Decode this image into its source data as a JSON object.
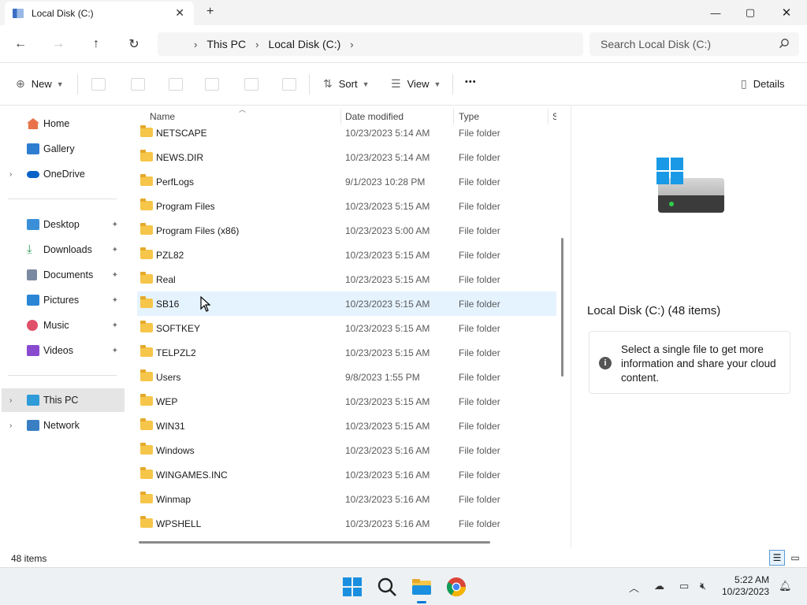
{
  "window": {
    "tab_title": "Local Disk (C:)",
    "tab_close": "✕",
    "new_tab": "+",
    "minimize": "—",
    "maximize": "▢",
    "close": "✕"
  },
  "address": {
    "crumbs": [
      "This PC",
      "Local Disk (C:)"
    ],
    "separator": "›",
    "search_placeholder": "Search Local Disk (C:)"
  },
  "commands": {
    "new_label": "New",
    "sort_label": "Sort",
    "view_label": "View",
    "more_label": "•••",
    "details_label": "Details"
  },
  "nav": {
    "top": [
      {
        "label": "Home",
        "icon": "home-icon",
        "color": "#e8734a"
      },
      {
        "label": "Gallery",
        "icon": "gallery-icon",
        "color": "#2e7dd1"
      },
      {
        "label": "OneDrive",
        "icon": "onedrive-icon",
        "color": "#0a64c8"
      }
    ],
    "pinned": [
      {
        "label": "Desktop",
        "icon": "desktop-icon",
        "color": "#3a8fd8"
      },
      {
        "label": "Downloads",
        "icon": "downloads-icon",
        "color": "#2e9b5a"
      },
      {
        "label": "Documents",
        "icon": "documents-icon",
        "color": "#7a8aa0"
      },
      {
        "label": "Pictures",
        "icon": "pictures-icon",
        "color": "#2a86d4"
      },
      {
        "label": "Music",
        "icon": "music-icon",
        "color": "#e0506a"
      },
      {
        "label": "Videos",
        "icon": "videos-icon",
        "color": "#8a4ad0"
      }
    ],
    "bottom": [
      {
        "label": "This PC",
        "icon": "this-pc-icon",
        "color": "#2f9bd8"
      },
      {
        "label": "Network",
        "icon": "network-icon",
        "color": "#3a7fc4"
      }
    ],
    "pin_glyph": "📌",
    "chevron": "›"
  },
  "columns": {
    "name": "Name",
    "date": "Date modified",
    "type": "Type",
    "size": "S"
  },
  "files": [
    {
      "name": "NETSCAPE",
      "date": "10/23/2023 5:14 AM",
      "type": "File folder"
    },
    {
      "name": "NEWS.DIR",
      "date": "10/23/2023 5:14 AM",
      "type": "File folder"
    },
    {
      "name": "PerfLogs",
      "date": "9/1/2023 10:28 PM",
      "type": "File folder"
    },
    {
      "name": "Program Files",
      "date": "10/23/2023 5:15 AM",
      "type": "File folder"
    },
    {
      "name": "Program Files (x86)",
      "date": "10/23/2023 5:00 AM",
      "type": "File folder"
    },
    {
      "name": "PZL82",
      "date": "10/23/2023 5:15 AM",
      "type": "File folder"
    },
    {
      "name": "Real",
      "date": "10/23/2023 5:15 AM",
      "type": "File folder"
    },
    {
      "name": "SB16",
      "date": "10/23/2023 5:15 AM",
      "type": "File folder"
    },
    {
      "name": "SOFTKEY",
      "date": "10/23/2023 5:15 AM",
      "type": "File folder"
    },
    {
      "name": "TELPZL2",
      "date": "10/23/2023 5:15 AM",
      "type": "File folder"
    },
    {
      "name": "Users",
      "date": "9/8/2023 1:55 PM",
      "type": "File folder"
    },
    {
      "name": "WEP",
      "date": "10/23/2023 5:15 AM",
      "type": "File folder"
    },
    {
      "name": "WIN31",
      "date": "10/23/2023 5:15 AM",
      "type": "File folder"
    },
    {
      "name": "Windows",
      "date": "10/23/2023 5:16 AM",
      "type": "File folder"
    },
    {
      "name": "WINGAMES.INC",
      "date": "10/23/2023 5:16 AM",
      "type": "File folder"
    },
    {
      "name": "Winmap",
      "date": "10/23/2023 5:16 AM",
      "type": "File folder"
    },
    {
      "name": "WPSHELL",
      "date": "10/23/2023 5:16 AM",
      "type": "File folder"
    }
  ],
  "details": {
    "title": "Local Disk (C:) (48 items)",
    "info_icon": "i",
    "info_text": "Select a single file to get more information and share your cloud content."
  },
  "status": {
    "count": "48 items"
  },
  "taskbar": {
    "time": "5:22 AM",
    "date": "10/23/2023",
    "tray_up": "︿"
  },
  "colors": {
    "accent": "#0078d4",
    "row_highlight": "#e5f3ff",
    "folder": "#f6c64a"
  }
}
